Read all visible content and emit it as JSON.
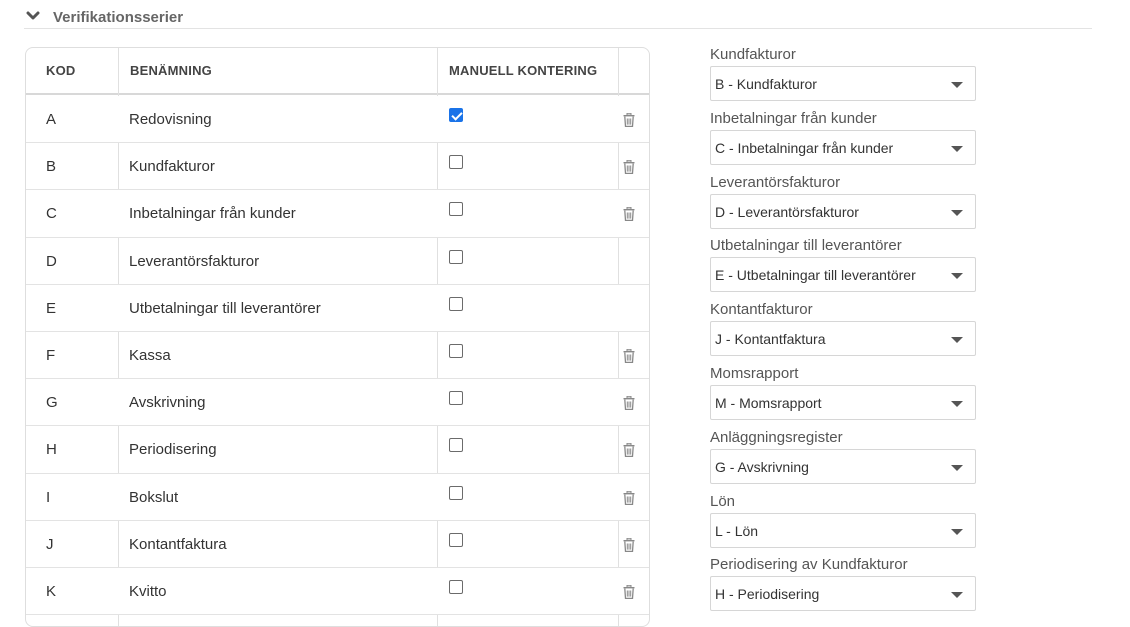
{
  "section": {
    "title": "Verifikationsserier",
    "icon": "chevron-down-icon"
  },
  "table": {
    "headers": {
      "kod": "KOD",
      "name": "BENÄMNING",
      "manual": "MANUELL KONTERING"
    },
    "rows": [
      {
        "kod": "A",
        "name": "Redovisning",
        "manual": true,
        "deletable": true
      },
      {
        "kod": "B",
        "name": "Kundfakturor",
        "manual": false,
        "deletable": true
      },
      {
        "kod": "C",
        "name": "Inbetalningar från kunder",
        "manual": false,
        "deletable": true
      },
      {
        "kod": "D",
        "name": "Leverantörsfakturor",
        "manual": false,
        "deletable": false
      },
      {
        "kod": "E",
        "name": "Utbetalningar till leverantörer",
        "manual": false,
        "deletable": false
      },
      {
        "kod": "F",
        "name": "Kassa",
        "manual": false,
        "deletable": true
      },
      {
        "kod": "G",
        "name": "Avskrivning",
        "manual": false,
        "deletable": true
      },
      {
        "kod": "H",
        "name": "Periodisering",
        "manual": false,
        "deletable": true
      },
      {
        "kod": "I",
        "name": "Bokslut",
        "manual": false,
        "deletable": true
      },
      {
        "kod": "J",
        "name": "Kontantfaktura",
        "manual": false,
        "deletable": true
      },
      {
        "kod": "K",
        "name": "Kvitto",
        "manual": false,
        "deletable": true
      }
    ]
  },
  "settings": [
    {
      "label": "Kundfakturor",
      "value": "B - Kundfakturor"
    },
    {
      "label": "Inbetalningar från kunder",
      "value": "C - Inbetalningar från kunder"
    },
    {
      "label": "Leverantörsfakturor",
      "value": "D - Leverantörsfakturor"
    },
    {
      "label": "Utbetalningar till leverantörer",
      "value": "E - Utbetalningar till leverantörer"
    },
    {
      "label": "Kontantfakturor",
      "value": "J - Kontantfaktura"
    },
    {
      "label": "Momsrapport",
      "value": "M - Momsrapport"
    },
    {
      "label": "Anläggningsregister",
      "value": "G - Avskrivning"
    },
    {
      "label": "Lön",
      "value": "L - Lön"
    },
    {
      "label": "Periodisering av Kundfakturor",
      "value": "H - Periodisering"
    }
  ],
  "colors": {
    "accent": "#1a73e8",
    "border": "#e3e3e3",
    "text": "#333333"
  }
}
